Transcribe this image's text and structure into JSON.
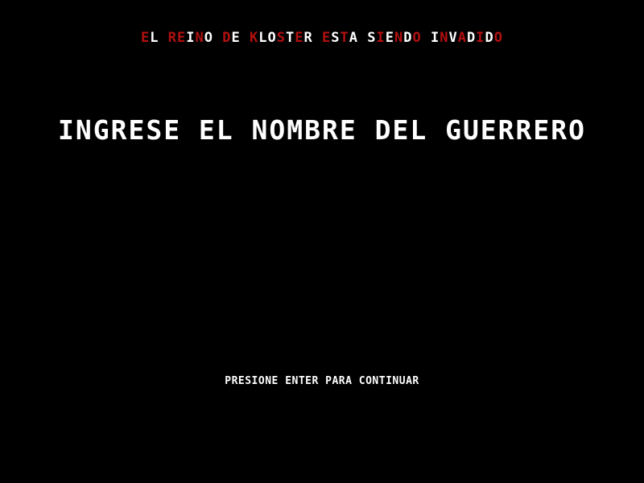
{
  "banner": {
    "text": "EL REINO DE KLOSTER ESTA SIENDO INVADIDO",
    "segments": [
      {
        "t": "E",
        "c": "red"
      },
      {
        "t": "L",
        "c": "white"
      },
      {
        "t": " ",
        "c": "white"
      },
      {
        "t": "RE",
        "c": "red"
      },
      {
        "t": "I",
        "c": "white"
      },
      {
        "t": "N",
        "c": "red"
      },
      {
        "t": "O",
        "c": "white"
      },
      {
        "t": " ",
        "c": "white"
      },
      {
        "t": "D",
        "c": "red"
      },
      {
        "t": "E",
        "c": "white"
      },
      {
        "t": " ",
        "c": "white"
      },
      {
        "t": "K",
        "c": "red"
      },
      {
        "t": "LO",
        "c": "white"
      },
      {
        "t": "S",
        "c": "red"
      },
      {
        "t": "T",
        "c": "white"
      },
      {
        "t": "E",
        "c": "red"
      },
      {
        "t": "R",
        "c": "white"
      },
      {
        "t": " ",
        "c": "white"
      },
      {
        "t": "E",
        "c": "red"
      },
      {
        "t": "S",
        "c": "white"
      },
      {
        "t": "T",
        "c": "red"
      },
      {
        "t": "A",
        "c": "white"
      },
      {
        "t": " ",
        "c": "white"
      },
      {
        "t": "S",
        "c": "white"
      },
      {
        "t": "I",
        "c": "red"
      },
      {
        "t": "E",
        "c": "white"
      },
      {
        "t": "N",
        "c": "red"
      },
      {
        "t": "D",
        "c": "white"
      },
      {
        "t": "O",
        "c": "red"
      },
      {
        "t": " ",
        "c": "white"
      },
      {
        "t": "I",
        "c": "white"
      },
      {
        "t": "N",
        "c": "red"
      },
      {
        "t": "V",
        "c": "white"
      },
      {
        "t": "A",
        "c": "red"
      },
      {
        "t": "D",
        "c": "white"
      },
      {
        "t": "I",
        "c": "red"
      },
      {
        "t": "D",
        "c": "white"
      },
      {
        "t": "O",
        "c": "red"
      }
    ]
  },
  "prompt": {
    "title": "INGRESE EL NOMBRE DEL GUERRERO"
  },
  "name_input": {
    "value": ""
  },
  "footer": {
    "continue_hint": "PRESIONE ENTER PARA CONTINUAR"
  },
  "colors": {
    "background": "#000000",
    "text": "#ffffff",
    "accent_red": "#b31010"
  }
}
